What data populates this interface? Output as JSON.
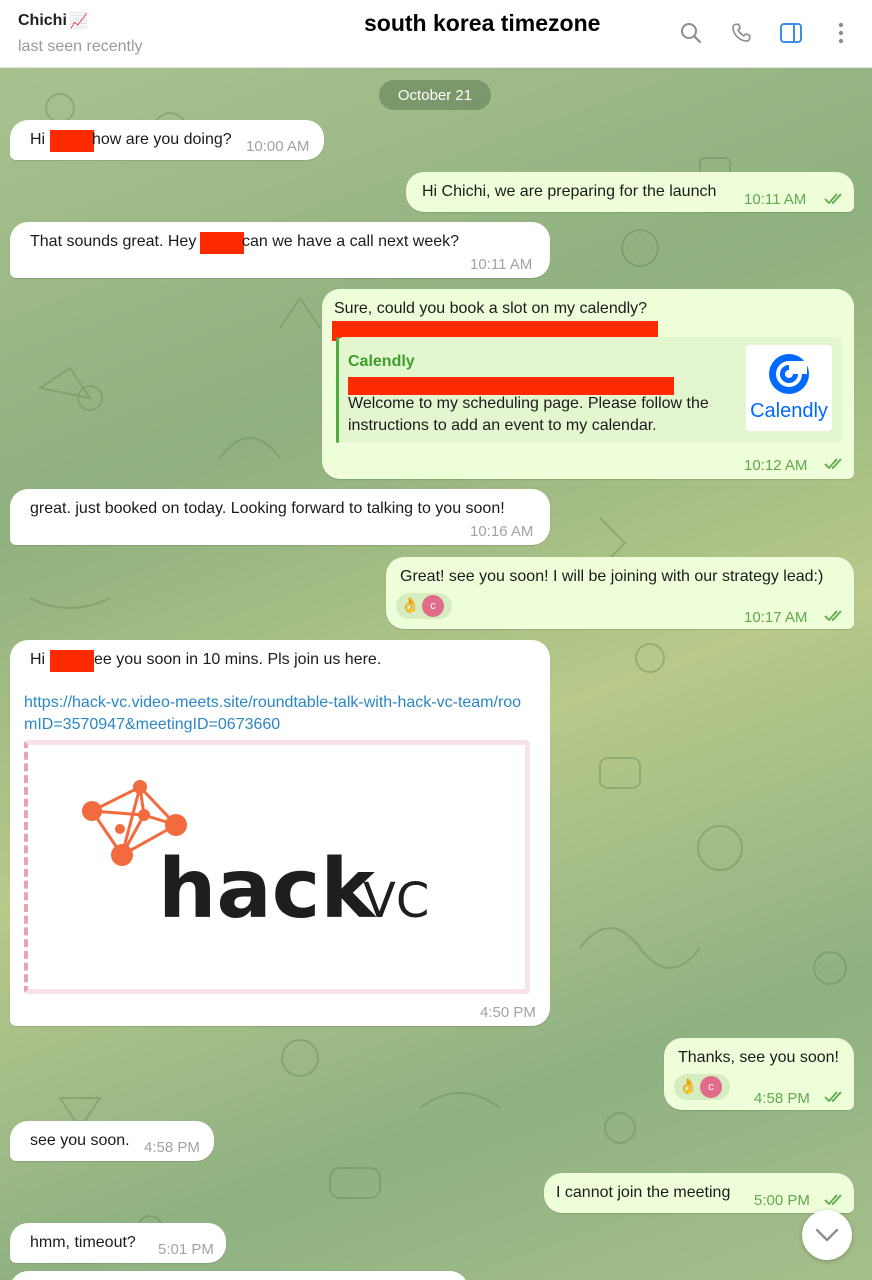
{
  "header": {
    "contact_name": "Chichi",
    "contact_emoji": "📈",
    "status": "last seen recently",
    "overlay_title": "south korea timezone",
    "icons": [
      "search-icon",
      "phone-icon",
      "sidebar-icon",
      "more-icon"
    ]
  },
  "chat": {
    "date_pill": "October 21",
    "messages": [
      {
        "side": "in",
        "text_before": "Hi",
        "text_after": "how are you doing?",
        "time": "10:00 AM"
      },
      {
        "side": "out",
        "text": "Hi Chichi, we are preparing for the launch",
        "time": "10:11 AM"
      },
      {
        "side": "in",
        "text_before": "That sounds great. Hey",
        "text_after": "can we have a call next week?",
        "time": "10:11 AM"
      },
      {
        "side": "out",
        "text": "Sure, could you book a slot on my calendly?",
        "time": "10:12 AM",
        "preview": {
          "site": "Calendly",
          "description": "Welcome to my scheduling page. Please follow the instructions to add an event to my calendar.",
          "thumb_label": "Calendly"
        }
      },
      {
        "side": "in",
        "text": "great. just booked on today. Looking forward to talking to you soon!",
        "time": "10:16 AM"
      },
      {
        "side": "out",
        "text": "Great! see you soon! I will be joining with our strategy lead:)",
        "time": "10:17 AM",
        "reaction": {
          "emoji": "👌",
          "avatar": "c"
        }
      },
      {
        "side": "in",
        "text_before": "Hi",
        "text_after": "ee you soon in 10 mins. Pls join us here.",
        "link": "https://hack-vc.video-meets.site/roundtable-talk-with-hack-vc-team/roomID=3570947&meetingID=0673660",
        "image_text_main": "hack",
        "image_text_sub": "VC",
        "time": "4:50 PM"
      },
      {
        "side": "out",
        "text": "Thanks, see you soon!",
        "time": "4:58 PM",
        "reaction": {
          "emoji": "👌",
          "avatar": "c"
        }
      },
      {
        "side": "in",
        "text": "see you soon.",
        "time": "4:58 PM"
      },
      {
        "side": "out",
        "text": "I cannot join the meeting",
        "time": "5:00 PM"
      },
      {
        "side": "in",
        "text": "hmm, timeout?",
        "time": "5:01 PM"
      }
    ]
  },
  "colors": {
    "incoming": "#ffffff",
    "outgoing": "#eefed9",
    "accent_green": "#4fae3f",
    "link": "#2b86c5",
    "redaction": "#ff2a00",
    "brand_orange": "#f26a3d"
  }
}
